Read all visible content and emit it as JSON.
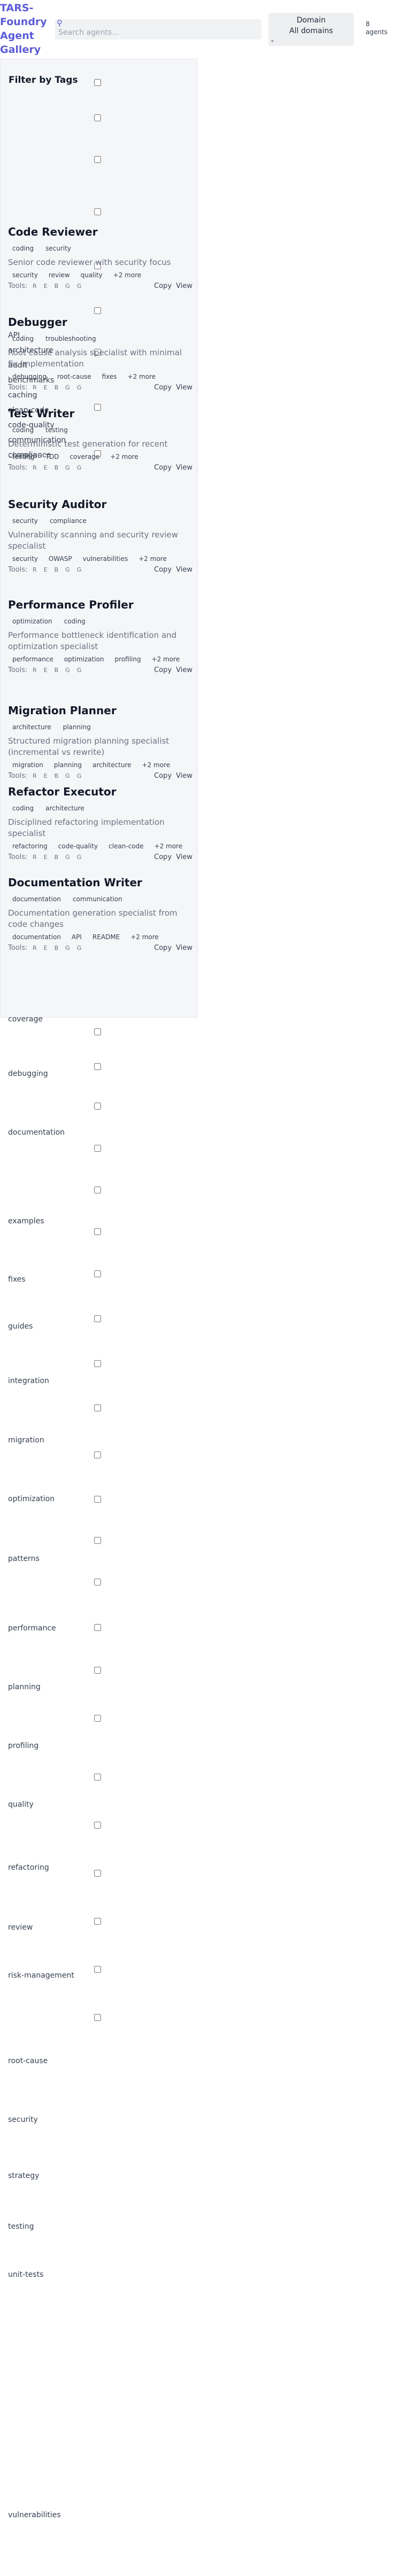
{
  "header": {
    "brand": "TARS-Foundry Agent Gallery",
    "search_placeholder": "Search agents...",
    "domain_label": "Domain",
    "domain_value": "All domains",
    "count_number": "8",
    "count_label": "agents"
  },
  "filter": {
    "title": "Filter by Tags",
    "tags": [
      "API",
      "architecture",
      "audit",
      "benchmarks",
      "caching",
      "clean-code",
      "code-quality",
      "communication",
      "compliance",
      "coverage",
      "debugging",
      "documentation",
      "examples",
      "fixes",
      "guides",
      "integration",
      "migration",
      "optimization",
      "patterns",
      "performance",
      "planning",
      "profiling",
      "quality",
      "refactoring",
      "review",
      "risk-management",
      "root-cause",
      "security",
      "strategy",
      "testing",
      "unit-tests",
      "vulnerabilities"
    ]
  },
  "cards": [
    {
      "title": "Code Reviewer",
      "tags": [
        "coding",
        "security"
      ],
      "desc": "Senior code reviewer with security focus",
      "keywords": [
        "security",
        "review",
        "quality",
        "+2 more"
      ]
    },
    {
      "title": "Debugger",
      "tags": [
        "coding",
        "troubleshooting"
      ],
      "desc": "Root cause analysis specialist with minimal fix implementation",
      "keywords": [
        "debugging",
        "root-cause",
        "fixes",
        "+2 more"
      ]
    },
    {
      "title": "Test Writer",
      "tags": [
        "coding",
        "testing"
      ],
      "desc": "Deterministic test generation for recent changes",
      "keywords": [
        "testing",
        "TDD",
        "coverage",
        "+2 more"
      ]
    },
    {
      "title": "Security Auditor",
      "tags": [
        "security",
        "compliance"
      ],
      "desc": "Vulnerability scanning and security review specialist",
      "keywords": [
        "security",
        "OWASP",
        "vulnerabilities",
        "+2 more"
      ]
    },
    {
      "title": "Performance Profiler",
      "tags": [
        "optimization",
        "coding"
      ],
      "desc": "Performance bottleneck identification and optimization specialist",
      "keywords": [
        "performance",
        "optimization",
        "profiling",
        "+2 more"
      ]
    },
    {
      "title": "Migration Planner",
      "tags": [
        "architecture",
        "planning"
      ],
      "desc": "Structured migration planning specialist (incremental vs rewrite)",
      "keywords": [
        "migration",
        "planning",
        "architecture",
        "+2 more"
      ]
    },
    {
      "title": "Refactor Executor",
      "tags": [
        "coding",
        "architecture"
      ],
      "desc": "Disciplined refactoring implementation specialist",
      "keywords": [
        "refactoring",
        "code-quality",
        "clean-code",
        "+2 more"
      ]
    },
    {
      "title": "Documentation Writer",
      "tags": [
        "documentation",
        "communication"
      ],
      "desc": "Documentation generation specialist from code changes",
      "keywords": [
        "documentation",
        "API",
        "README",
        "+2 more"
      ]
    }
  ],
  "card_common": {
    "tools_label": "Tools:",
    "tool_letters": [
      "R",
      "E",
      "B",
      "G",
      "G"
    ],
    "copy_label": "Copy",
    "view_label": "View"
  }
}
